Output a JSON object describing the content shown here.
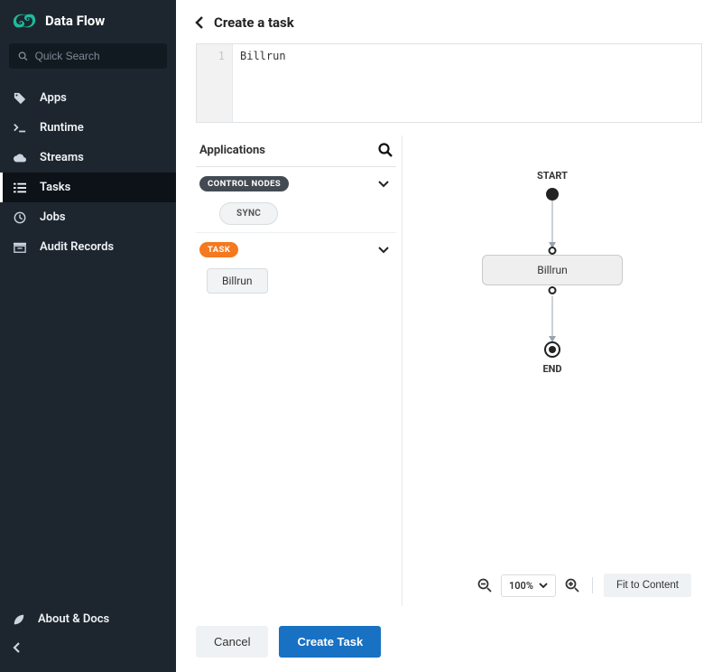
{
  "brand": {
    "title": "Data Flow"
  },
  "search": {
    "placeholder": "Quick Search"
  },
  "sidebar": {
    "items": [
      {
        "label": "Apps"
      },
      {
        "label": "Runtime"
      },
      {
        "label": "Streams"
      },
      {
        "label": "Tasks"
      },
      {
        "label": "Jobs"
      },
      {
        "label": "Audit Records"
      }
    ],
    "about": "About & Docs"
  },
  "header": {
    "title": "Create a task"
  },
  "code": {
    "line_no": "1",
    "content": "Billrun"
  },
  "apps_panel": {
    "title": "Applications",
    "sections": {
      "control": {
        "badge": "CONTROL NODES",
        "items": [
          "SYNC"
        ]
      },
      "task": {
        "badge": "TASK",
        "items": [
          "Billrun"
        ]
      }
    }
  },
  "canvas": {
    "start": "START",
    "end": "END",
    "task_name": "Billrun"
  },
  "zoom": {
    "level": "100%",
    "fit": "Fit to Content"
  },
  "actions": {
    "cancel": "Cancel",
    "create": "Create Task"
  }
}
